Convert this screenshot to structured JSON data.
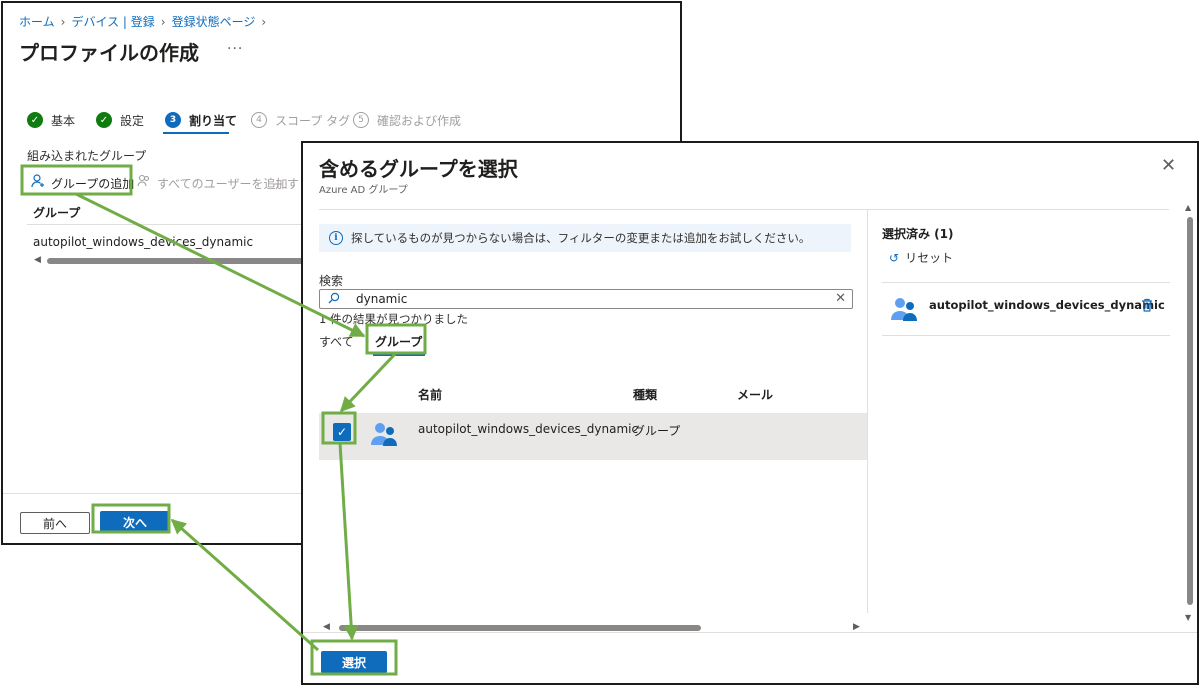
{
  "breadcrumb": [
    "ホーム",
    "デバイス | 登録",
    "登録状態ページ"
  ],
  "page": {
    "title": "プロファイルの作成",
    "more": "···"
  },
  "steps": [
    {
      "num": "",
      "label": "基本",
      "state": "done"
    },
    {
      "num": "",
      "label": "設定",
      "state": "done"
    },
    {
      "num": "3",
      "label": "割り当て",
      "state": "current"
    },
    {
      "num": "4",
      "label": "スコープ タグ",
      "state": "todo"
    },
    {
      "num": "5",
      "label": "確認および作成",
      "state": "todo"
    }
  ],
  "assign": {
    "section_label": "組み込まれたグループ",
    "add_group": "グループの追加",
    "add_all_users": "すべてのユーザーを追加",
    "add_more": "+ す",
    "column_group": "グループ",
    "row": "autopilot_windows_devices_dynamic"
  },
  "footer": {
    "prev": "前へ",
    "next": "次へ"
  },
  "dialog": {
    "title": "含めるグループを選択",
    "subtitle": "Azure AD グループ",
    "close": "✕",
    "info": "探しているものが見つからない場合は、フィルターの変更または追加をお試しください。",
    "search_label": "検索",
    "search_value": "dynamic",
    "result_count": "1 件の結果が見つかりました",
    "tabs": [
      "すべて",
      "グループ"
    ],
    "columns": [
      "名前",
      "種類",
      "メール"
    ],
    "row": {
      "name": "autopilot_windows_devices_dynamic",
      "type": "グループ",
      "mail": ""
    },
    "selected_title": "選択済み (1)",
    "reset": "リセット",
    "selected_item": "autopilot_windows_devices_dynamic",
    "select_button": "選択"
  },
  "colors": {
    "accent": "#0f6cbd",
    "success": "#107c10",
    "annotation": "#70ad47"
  }
}
